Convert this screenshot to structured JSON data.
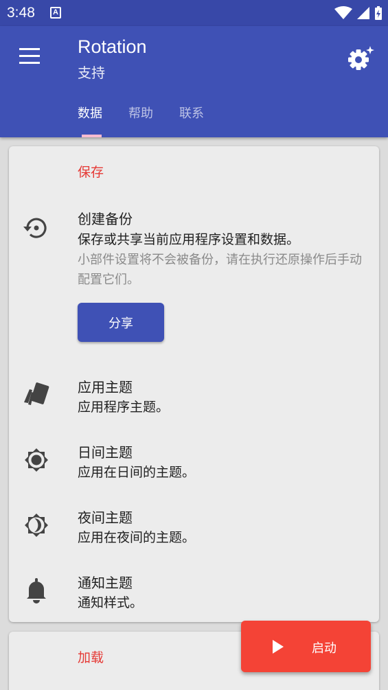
{
  "status": {
    "time": "3:48",
    "notification_letter": "A"
  },
  "app": {
    "title": "Rotation",
    "subtitle": "支持"
  },
  "tabs": [
    {
      "label": "数据",
      "active": true
    },
    {
      "label": "帮助",
      "active": false
    },
    {
      "label": "联系",
      "active": false
    }
  ],
  "colors": {
    "primary": "#3f51b5",
    "status_bar": "#3848a8",
    "accent": "#f44336",
    "section_header": "#e53935",
    "tab_indicator": "#f8bbd0"
  },
  "save_section": {
    "header": "保存",
    "backup": {
      "icon": "backup-restore-icon",
      "title": "创建备份",
      "summary": "保存或共享当前应用程序设置和数据。",
      "hint": "小部件设置将不会被备份，请在执行还原操作后手动配置它们。",
      "button": "分享"
    },
    "items": [
      {
        "icon": "theme-cards-icon",
        "title": "应用主题",
        "summary": "应用程序主题。"
      },
      {
        "icon": "brightness-high-icon",
        "title": "日间主题",
        "summary": "应用在日间的主题。"
      },
      {
        "icon": "brightness-night-icon",
        "title": "夜间主题",
        "summary": "应用在夜间的主题。"
      },
      {
        "icon": "bell-icon",
        "title": "通知主题",
        "summary": "通知样式。"
      }
    ]
  },
  "load_section": {
    "header": "加载"
  },
  "fab": {
    "icon": "play-icon",
    "label": "启动"
  }
}
